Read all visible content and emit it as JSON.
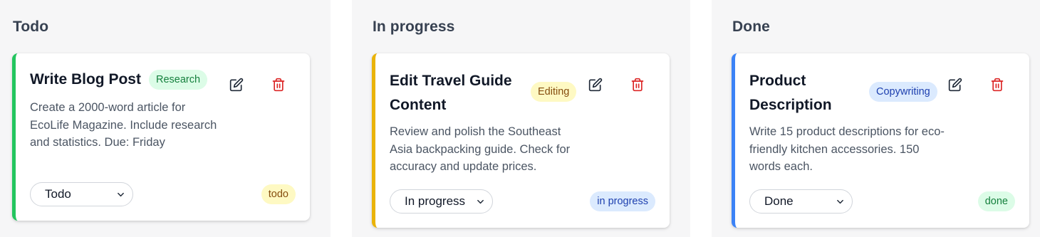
{
  "columns": [
    {
      "title": "Todo",
      "card": {
        "title": "Write Blog Post",
        "category": "Research",
        "description": "Create a 2000-word article for EcoLife Magazine. Include research and statistics. Due: Friday",
        "status_select": "Todo",
        "status_badge": "todo",
        "accent_color": "#22c55e"
      }
    },
    {
      "title": "In progress",
      "card": {
        "title": "Edit Travel Guide Content",
        "category": "Editing",
        "description": "Review and polish the Southeast Asia backpacking guide. Check for accuracy and update prices.",
        "status_select": "In progress",
        "status_badge": "in progress",
        "accent_color": "#eab308"
      }
    },
    {
      "title": "Done",
      "card": {
        "title": "Product Description",
        "category": "Copywriting",
        "description": "Write 15 product descriptions for eco-friendly kitchen accessories. 150 words each.",
        "status_select": "Done",
        "status_badge": "done",
        "accent_color": "#3b82f6"
      }
    }
  ],
  "icons": {
    "edit": "edit-icon",
    "delete": "trash-icon",
    "select": "chevron-down-icon"
  }
}
